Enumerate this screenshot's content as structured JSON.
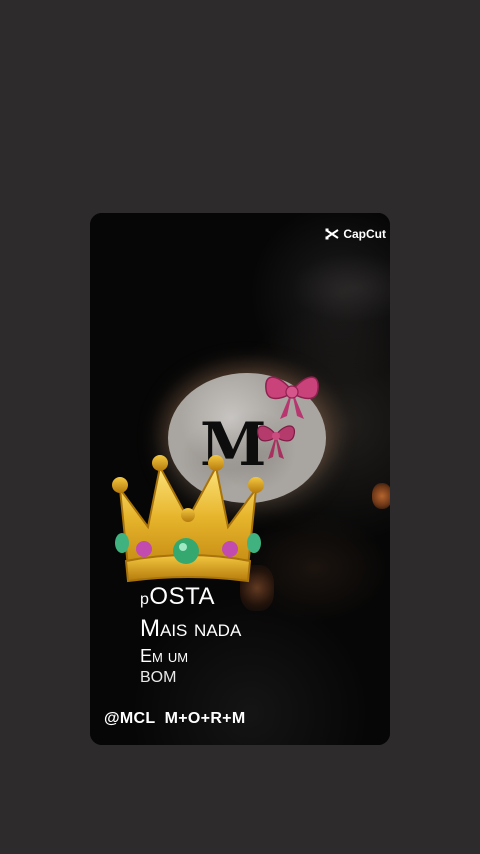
{
  "watermark": {
    "brand": "CapCut",
    "icon": "capcut-logo-icon"
  },
  "video": {
    "monogram": "M",
    "caption": {
      "line1_prefix": "p",
      "line1_rest": "OSTA",
      "line2": "Mais nada",
      "line3": "Em um",
      "line4": "bom"
    },
    "credit": "@MCL  M+O+R+M",
    "decorations": [
      "crown-emoji",
      "pink-bow-large",
      "pink-bow-small",
      "full-moon"
    ]
  }
}
